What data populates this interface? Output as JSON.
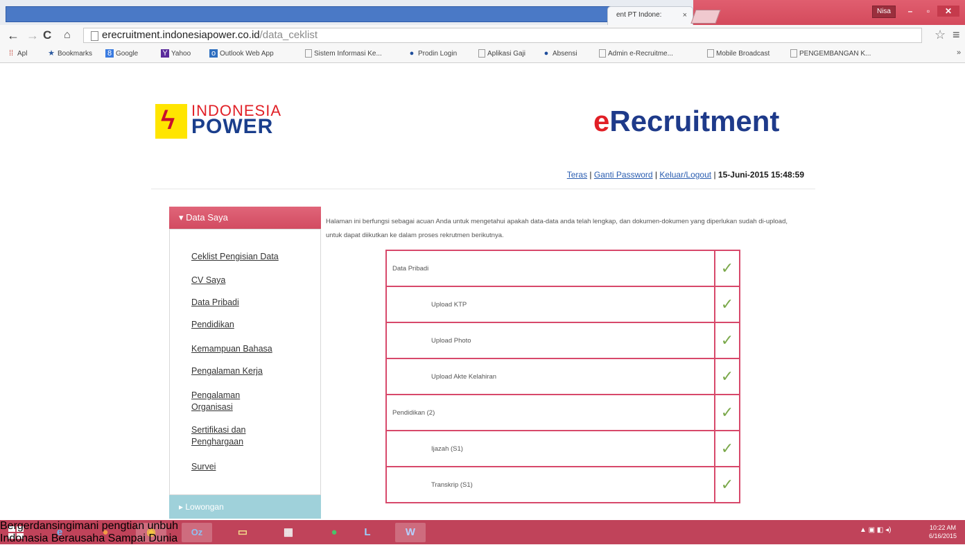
{
  "browser": {
    "tab_title": "ent PT Indone:",
    "tab_close": "×",
    "user_badge": "Nisa",
    "win_min": "–",
    "win_max": "▫",
    "win_close": "✕",
    "url_host": "erecruitment.indonesiapower.co.id",
    "url_path": "/data_ceklist",
    "nav_back": "←",
    "nav_forward": "→",
    "nav_reload": "C",
    "nav_home": "⌂",
    "star": "☆",
    "menu": "≡",
    "bookmarks": [
      {
        "label": "Apl",
        "icon": "apps-icon"
      },
      {
        "label": "Bookmarks",
        "icon": "star-icon"
      },
      {
        "label": "Google",
        "icon": "google-icon"
      },
      {
        "label": "Yahoo",
        "icon": "yahoo-icon"
      },
      {
        "label": "Outlook Web App",
        "icon": "outlook-icon"
      },
      {
        "label": "Sistem Informasi Ke...",
        "icon": "page-icon"
      },
      {
        "label": "Prodin Login",
        "icon": "globe-icon"
      },
      {
        "label": "Aplikasi Gaji",
        "icon": "page-icon"
      },
      {
        "label": "Absensi",
        "icon": "globe-icon"
      },
      {
        "label": "Admin e-Recruitme...",
        "icon": "page-icon"
      },
      {
        "label": "Mobile Broadcast",
        "icon": "page-icon"
      },
      {
        "label": "PENGEMBANGAN K...",
        "icon": "page-icon"
      }
    ],
    "bookmarks_more": "»"
  },
  "header": {
    "logo_line1": "INDONESIA",
    "logo_line2": "POWER",
    "title_e": "e",
    "title_rest": "Recruitment",
    "links": {
      "home": "Teras",
      "sep": " | ",
      "password": "Ganti Password",
      "logout": "Keluar/Logout"
    },
    "timestamp": "15-Juni-2015 15:48:59"
  },
  "sidebar": {
    "section1": "Data Saya",
    "links": [
      "Ceklist Pengisian Data",
      "CV Saya",
      "Data Pribadi",
      "Pendidikan",
      "Kemampuan Bahasa",
      "Pengalaman Kerja",
      "Pengalaman Organisasi",
      "Sertifikasi dan Penghargaan",
      "Survei"
    ],
    "section2": "Lowongan"
  },
  "main": {
    "intro": "Halaman ini berfungsi sebagai acuan Anda untuk mengetahui apakah data-data anda telah lengkap, dan dokumen-dokumen yang diperlukan sudah di-upload, untuk dapat diikutkan ke dalam proses rekrutmen berikutnya.",
    "check_mark": "✓",
    "checklist": [
      {
        "label": "Data Pribadi",
        "indent": false,
        "done": true
      },
      {
        "label": "Upload KTP",
        "indent": true,
        "done": true
      },
      {
        "label": "Upload Photo",
        "indent": true,
        "done": true
      },
      {
        "label": "Upload Akte Kelahiran",
        "indent": true,
        "done": true
      },
      {
        "label": "Pendidikan (2)",
        "indent": false,
        "done": true
      },
      {
        "label": "Ijazah (S1)",
        "indent": true,
        "done": true
      },
      {
        "label": "Transkrip (S1)",
        "indent": true,
        "done": true
      }
    ]
  },
  "taskbar": {
    "apps": [
      {
        "name": "ie-icon",
        "glyph": "e",
        "color": "#3a8fd6"
      },
      {
        "name": "firefox-icon",
        "glyph": "●",
        "color": "#e8761f"
      },
      {
        "name": "chrome-icon",
        "glyph": "◉",
        "color": "#e9b32d"
      },
      {
        "name": "outlook-icon",
        "glyph": "Oz",
        "color": "#2f6fc0"
      },
      {
        "name": "explorer-icon",
        "glyph": "▭",
        "color": "#e9cc6a"
      },
      {
        "name": "calculator-icon",
        "glyph": "▦",
        "color": "#d6d6d6"
      },
      {
        "name": "whatsapp-icon",
        "glyph": "●",
        "color": "#2aa64a"
      },
      {
        "name": "lync-icon",
        "glyph": "L",
        "color": "#2e7fd1"
      },
      {
        "name": "word-icon",
        "glyph": "W",
        "color": "#2b5fb4"
      }
    ],
    "overlay_line1": "Bergerdansingimani pengtian unbuh",
    "overlay_line2": "Indonasia Berausaha Sampai Dunia",
    "clock_time": "10:22 AM",
    "clock_date": "6/16/2015"
  }
}
